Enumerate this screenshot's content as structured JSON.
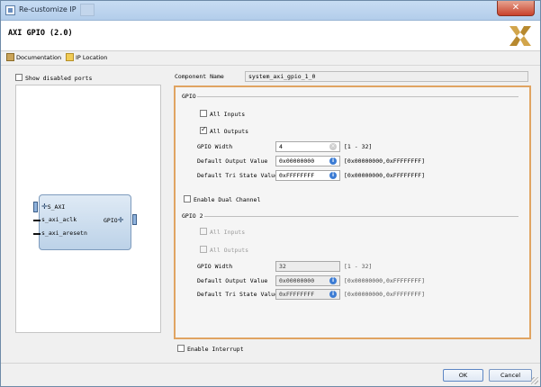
{
  "window": {
    "title": "Re-customize IP",
    "close_glyph": "✕",
    "ip_name": "AXI GPIO (2.0)",
    "logo_icon": "xilinx-logo-icon"
  },
  "toolbar": {
    "documentation": "Documentation",
    "ip_location": "IP Location"
  },
  "left": {
    "show_disabled_ports": "Show disabled ports",
    "block": {
      "bus_port": "S_AXI",
      "aclk": "s_axi_aclk",
      "aresetn": "s_axi_aresetn",
      "gpio": "GPIO"
    }
  },
  "component": {
    "label": "Component Name",
    "value": "system_axi_gpio_1_0"
  },
  "gpio": {
    "title": "GPIO",
    "all_inputs": "All Inputs",
    "all_outputs": "All Outputs",
    "width_label": "GPIO Width",
    "width_value": "4",
    "width_range": "[1 - 32]",
    "dout_label": "Default Output Value",
    "dout_value": "0x00000000",
    "dout_range": "[0x00000000,0xFFFFFFFF]",
    "tri_label": "Default Tri State Value",
    "tri_value": "0xFFFFFFFF",
    "tri_range": "[0x00000000,0xFFFFFFFF]",
    "checks": {
      "all_inputs": false,
      "all_outputs": true
    }
  },
  "dual": {
    "label": "Enable Dual Channel",
    "checked": false
  },
  "gpio2": {
    "title": "GPIO 2",
    "all_inputs": "All Inputs",
    "all_outputs": "All Outputs",
    "width_label": "GPIO Width",
    "width_value": "32",
    "width_range": "[1 - 32]",
    "dout_label": "Default Output Value",
    "dout_value": "0x00000000",
    "dout_range": "[0x00000000,0xFFFFFFFF]",
    "tri_label": "Default Tri State Value",
    "tri_value": "0xFFFFFFFF",
    "tri_range": "[0x00000000,0xFFFFFFFF]"
  },
  "interrupt": {
    "label": "Enable Interrupt",
    "checked": false
  },
  "buttons": {
    "ok": "OK",
    "cancel": "Cancel"
  },
  "glyphs": {
    "plus": "✛",
    "info": "i",
    "clear": "×"
  },
  "colors": {
    "highlight_border": "#e0a462",
    "ok_border": "#7a98c4"
  }
}
